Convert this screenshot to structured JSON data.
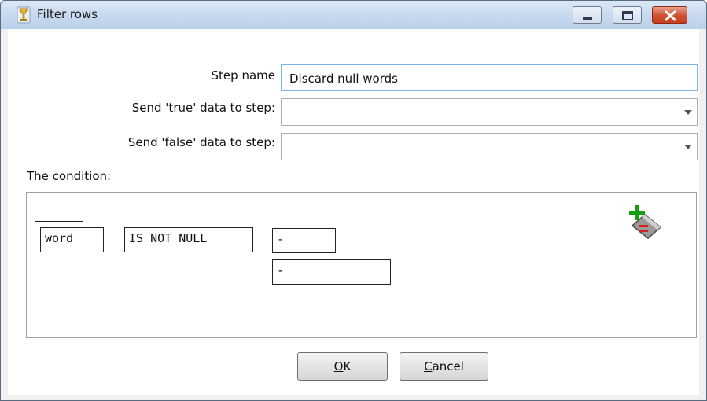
{
  "window": {
    "title": "Filter rows",
    "app_icon": "spoon-icon",
    "controls": [
      "minimize-icon",
      "maximize-icon",
      "close-icon"
    ]
  },
  "form": {
    "step_name_label": "Step name",
    "step_name_value": "Discard null words",
    "send_true_label": "Send 'true' data to step:",
    "send_true_value": "",
    "send_false_label": "Send 'false' data to step:",
    "send_false_value": ""
  },
  "condition": {
    "title": "The condition:",
    "negate_box": "",
    "field": "word",
    "function": "IS NOT NULL",
    "compare_field": "-",
    "compare_value": "-",
    "add_icon": "add-condition-icon"
  },
  "buttons": {
    "ok": {
      "mnemonic": "O",
      "rest": "K"
    },
    "cancel": {
      "mnemonic": "C",
      "rest": "ancel"
    }
  }
}
